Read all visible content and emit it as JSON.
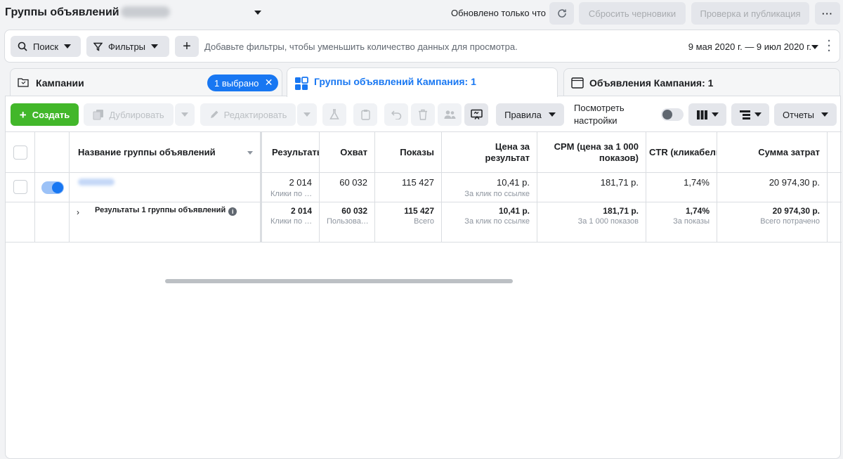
{
  "header": {
    "title": "Группы объявлений",
    "updated": "Обновлено только что",
    "discard_label": "Сбросить черновики",
    "publish_label": "Проверка и публикация",
    "more_label": "···"
  },
  "filterbar": {
    "search_label": "Поиск",
    "filters_label": "Фильтры",
    "add_label": "+",
    "hint": "Добавьте фильтры, чтобы уменьшить количество данных для просмотра.",
    "date_range": "9 мая 2020 г. — 9 июл 2020 г."
  },
  "tabs": [
    {
      "label": "Кампании",
      "selected_badge": "1 выбрано"
    },
    {
      "label": "Группы объявлений Кампания: 1"
    },
    {
      "label": "Объявления Кампания: 1"
    }
  ],
  "toolbar": {
    "create_label": "Создать",
    "duplicate_label": "Дублировать",
    "edit_label": "Редактировать",
    "rules_label": "Правила",
    "view_settings_line1": "Посмотреть",
    "view_settings_line2": "настройки",
    "reports_label": "Отчеты"
  },
  "table": {
    "columns": [
      "Название группы объявлений",
      "Результаты",
      "Охват",
      "Показы",
      "Цена за результат",
      "CPM (цена за 1 000 показов)",
      "CTR (кликабельность)",
      "Сумма затрат"
    ],
    "rows": [
      {
        "results": "2 014",
        "results_sub": "Клики по ссылке",
        "reach": "60 032",
        "impressions": "115 427",
        "cpr": "10,41 р.",
        "cpr_sub": "За клик по ссылке",
        "cpm": "181,71 р.",
        "ctr": "1,74%",
        "spend": "20 974,30 р."
      }
    ],
    "summary": {
      "label": "Результаты 1 группы объявлений",
      "results": "2 014",
      "results_sub": "Клики по ссылке",
      "reach": "60 032",
      "reach_sub": "Пользователи",
      "impressions": "115 427",
      "impressions_sub": "Всего",
      "cpr": "10,41 р.",
      "cpr_sub": "За клик по ссылке",
      "cpm": "181,71 р.",
      "cpm_sub": "За 1 000 показов",
      "ctr": "1,74%",
      "ctr_sub": "За показы",
      "spend": "20 974,30 р.",
      "spend_sub": "Всего потрачено"
    }
  },
  "colors": {
    "accent": "#1877f2",
    "create_green": "#42b72a",
    "border": "#dadde1",
    "background": "#f2f3f5"
  }
}
